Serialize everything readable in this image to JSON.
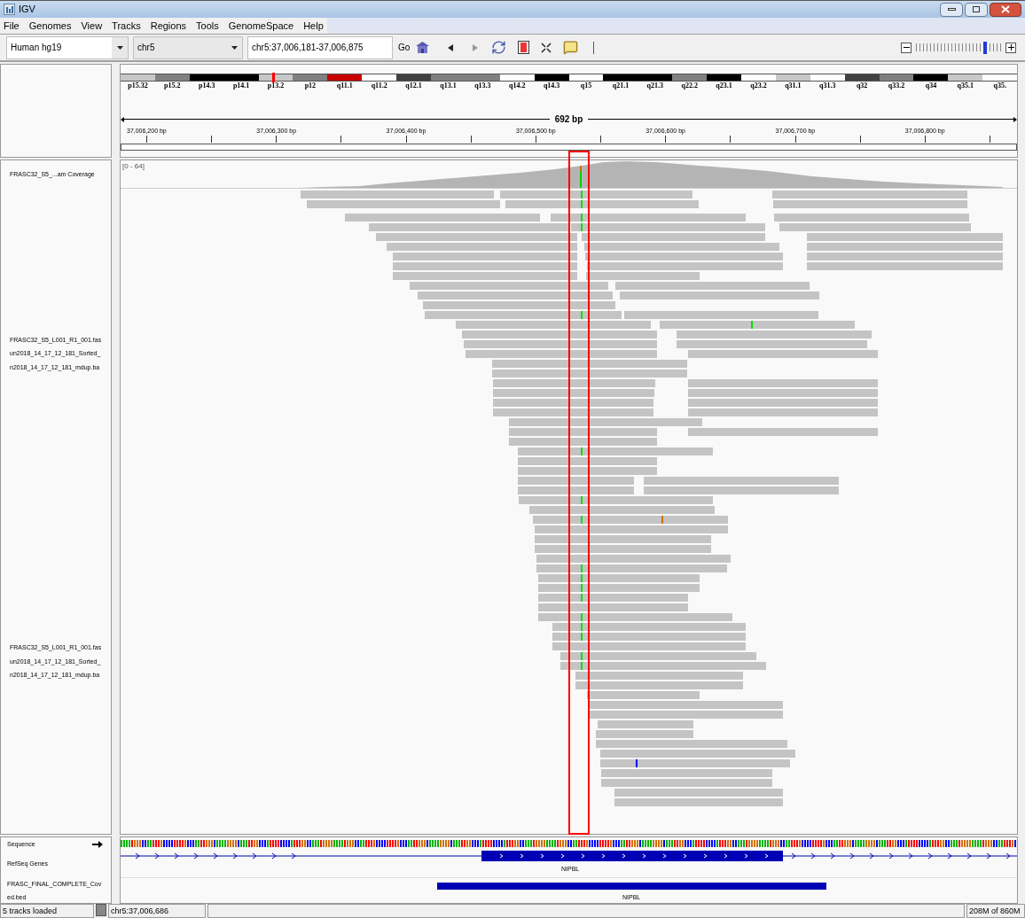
{
  "window": {
    "title": "IGV"
  },
  "menu": [
    "File",
    "Genomes",
    "View",
    "Tracks",
    "Regions",
    "Tools",
    "GenomeSpace",
    "Help"
  ],
  "toolbar": {
    "genome": "Human hg19",
    "chromosome": "chr5",
    "locus": "chr5:37,006,181-37,006,875",
    "go": "Go",
    "zoom": {
      "level": 0.83
    }
  },
  "ideogram": {
    "bands": [
      {
        "label": "p15.32",
        "color": "#c8c8c8",
        "current": false
      },
      {
        "label": "p15.2",
        "color": "#808080",
        "current": false
      },
      {
        "label": "p14.3",
        "color": "#000000",
        "current": false
      },
      {
        "label": "p14.1",
        "color": "#000000",
        "current": false
      },
      {
        "label": "p13.2",
        "color": "#c8c8c8",
        "current": true
      },
      {
        "label": "p12",
        "color": "#808080",
        "current": false
      },
      {
        "label": "q11.1",
        "color": "#c80000",
        "current": false
      },
      {
        "label": "q11.2",
        "color": "#ffffff",
        "current": false
      },
      {
        "label": "q12.1",
        "color": "#404040",
        "current": false
      },
      {
        "label": "q13.1",
        "color": "#808080",
        "current": false
      },
      {
        "label": "q13.3",
        "color": "#808080",
        "current": false
      },
      {
        "label": "q14.2",
        "color": "#ffffff",
        "current": false
      },
      {
        "label": "q14.3",
        "color": "#000000",
        "current": false
      },
      {
        "label": "q15",
        "color": "#ffffff",
        "current": false
      },
      {
        "label": "q21.1",
        "color": "#000000",
        "current": false
      },
      {
        "label": "q21.3",
        "color": "#000000",
        "current": false
      },
      {
        "label": "q22.2",
        "color": "#808080",
        "current": false
      },
      {
        "label": "q23.1",
        "color": "#000000",
        "current": false
      },
      {
        "label": "q23.2",
        "color": "#ffffff",
        "current": false
      },
      {
        "label": "q31.1",
        "color": "#c8c8c8",
        "current": false
      },
      {
        "label": "q31.3",
        "color": "#ffffff",
        "current": false
      },
      {
        "label": "q32",
        "color": "#404040",
        "current": false
      },
      {
        "label": "q33.2",
        "color": "#808080",
        "current": false
      },
      {
        "label": "q34",
        "color": "#000000",
        "current": false
      },
      {
        "label": "q35.1",
        "color": "#c8c8c8",
        "current": false
      },
      {
        "label": "q35.",
        "color": "#ffffff",
        "current": false
      }
    ]
  },
  "ruler": {
    "span": "692 bp",
    "ticks": [
      "37,006,200 bp",
      "37,006,300 bp",
      "37,006,400 bp",
      "37,006,500 bp",
      "37,006,600 bp",
      "37,006,700 bp",
      "37,006,800 bp"
    ]
  },
  "coverage_track": {
    "name": "FRASC32_S5_...am Coverage",
    "range": "[0 - 64]"
  },
  "alignment_track": {
    "labels": [
      [
        "FRASC32_S5_L001_R1_001.fas",
        "un2018_14_17_12_181_Sorted_",
        "n2018_14_17_12_181_mdup.ba"
      ],
      [
        "FRASC32_S5_L001_R1_001.fas",
        "un2018_14_17_12_181_Sorted_",
        "n2018_14_17_12_181_mdup.ba"
      ]
    ]
  },
  "sequence_track": {
    "name": "Sequence"
  },
  "refseq_track": {
    "name": "RefSeq Genes",
    "gene": "NIPBL"
  },
  "bed_track": {
    "name_lines": [
      "FRASC_FINAL_COMPLETE_Cov",
      "ed.bed"
    ],
    "feature": "NIPBL"
  },
  "status_bar": {
    "tracks": "5 tracks loaded",
    "position": "chr5:37,006,686",
    "memory": "208M of 860M"
  }
}
